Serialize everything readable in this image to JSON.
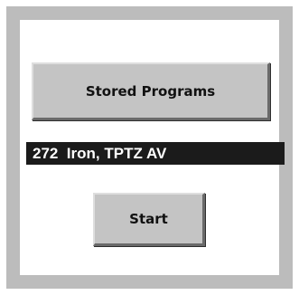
{
  "buttons": {
    "stored_programs_label": "Stored Programs",
    "start_label": "Start"
  },
  "status": {
    "program_text": "272  Iron, TPTZ AV"
  }
}
